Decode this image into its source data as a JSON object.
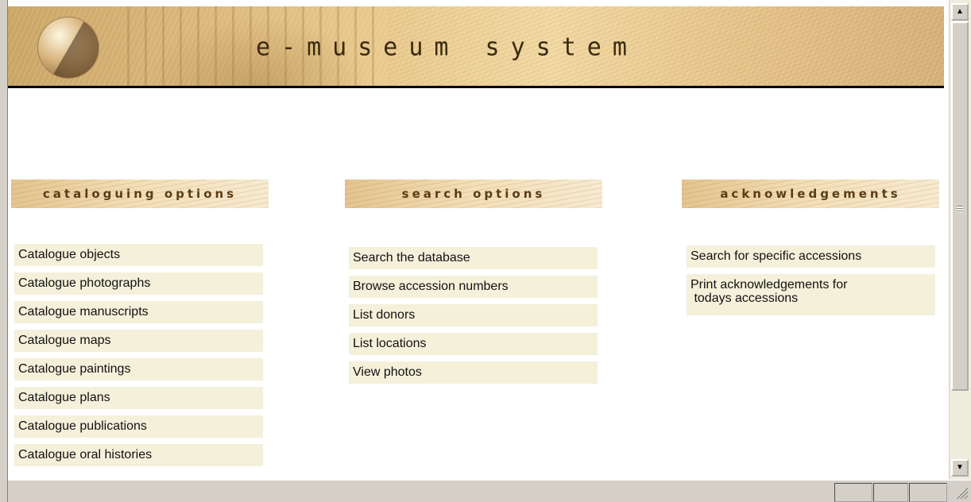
{
  "banner": {
    "title": "e-museum system"
  },
  "cataloguing": {
    "heading": "cataloguing options",
    "items": [
      "Catalogue objects",
      "Catalogue photographs",
      "Catalogue manuscripts",
      "Catalogue maps",
      "Catalogue paintings",
      "Catalogue plans",
      "Catalogue publications",
      "Catalogue oral histories"
    ]
  },
  "search": {
    "heading": "search options",
    "items": [
      "Search the database",
      "Browse accession numbers",
      "List donors",
      "List locations",
      "View photos"
    ]
  },
  "acknowledgements": {
    "heading": "acknowledgements",
    "items": [
      "Search for specific accessions",
      "Print acknowledgements for\n todays accessions"
    ]
  },
  "icons": {
    "scroll_up": "chevron-up-icon",
    "scroll_down": "chevron-down-icon",
    "logo": "museum-logo-icon",
    "resize": "resize-grip-icon"
  },
  "colors": {
    "menu_item_bg": "#f4f0da",
    "header_text": "#5a3d16",
    "banner_rule": "#000000"
  }
}
